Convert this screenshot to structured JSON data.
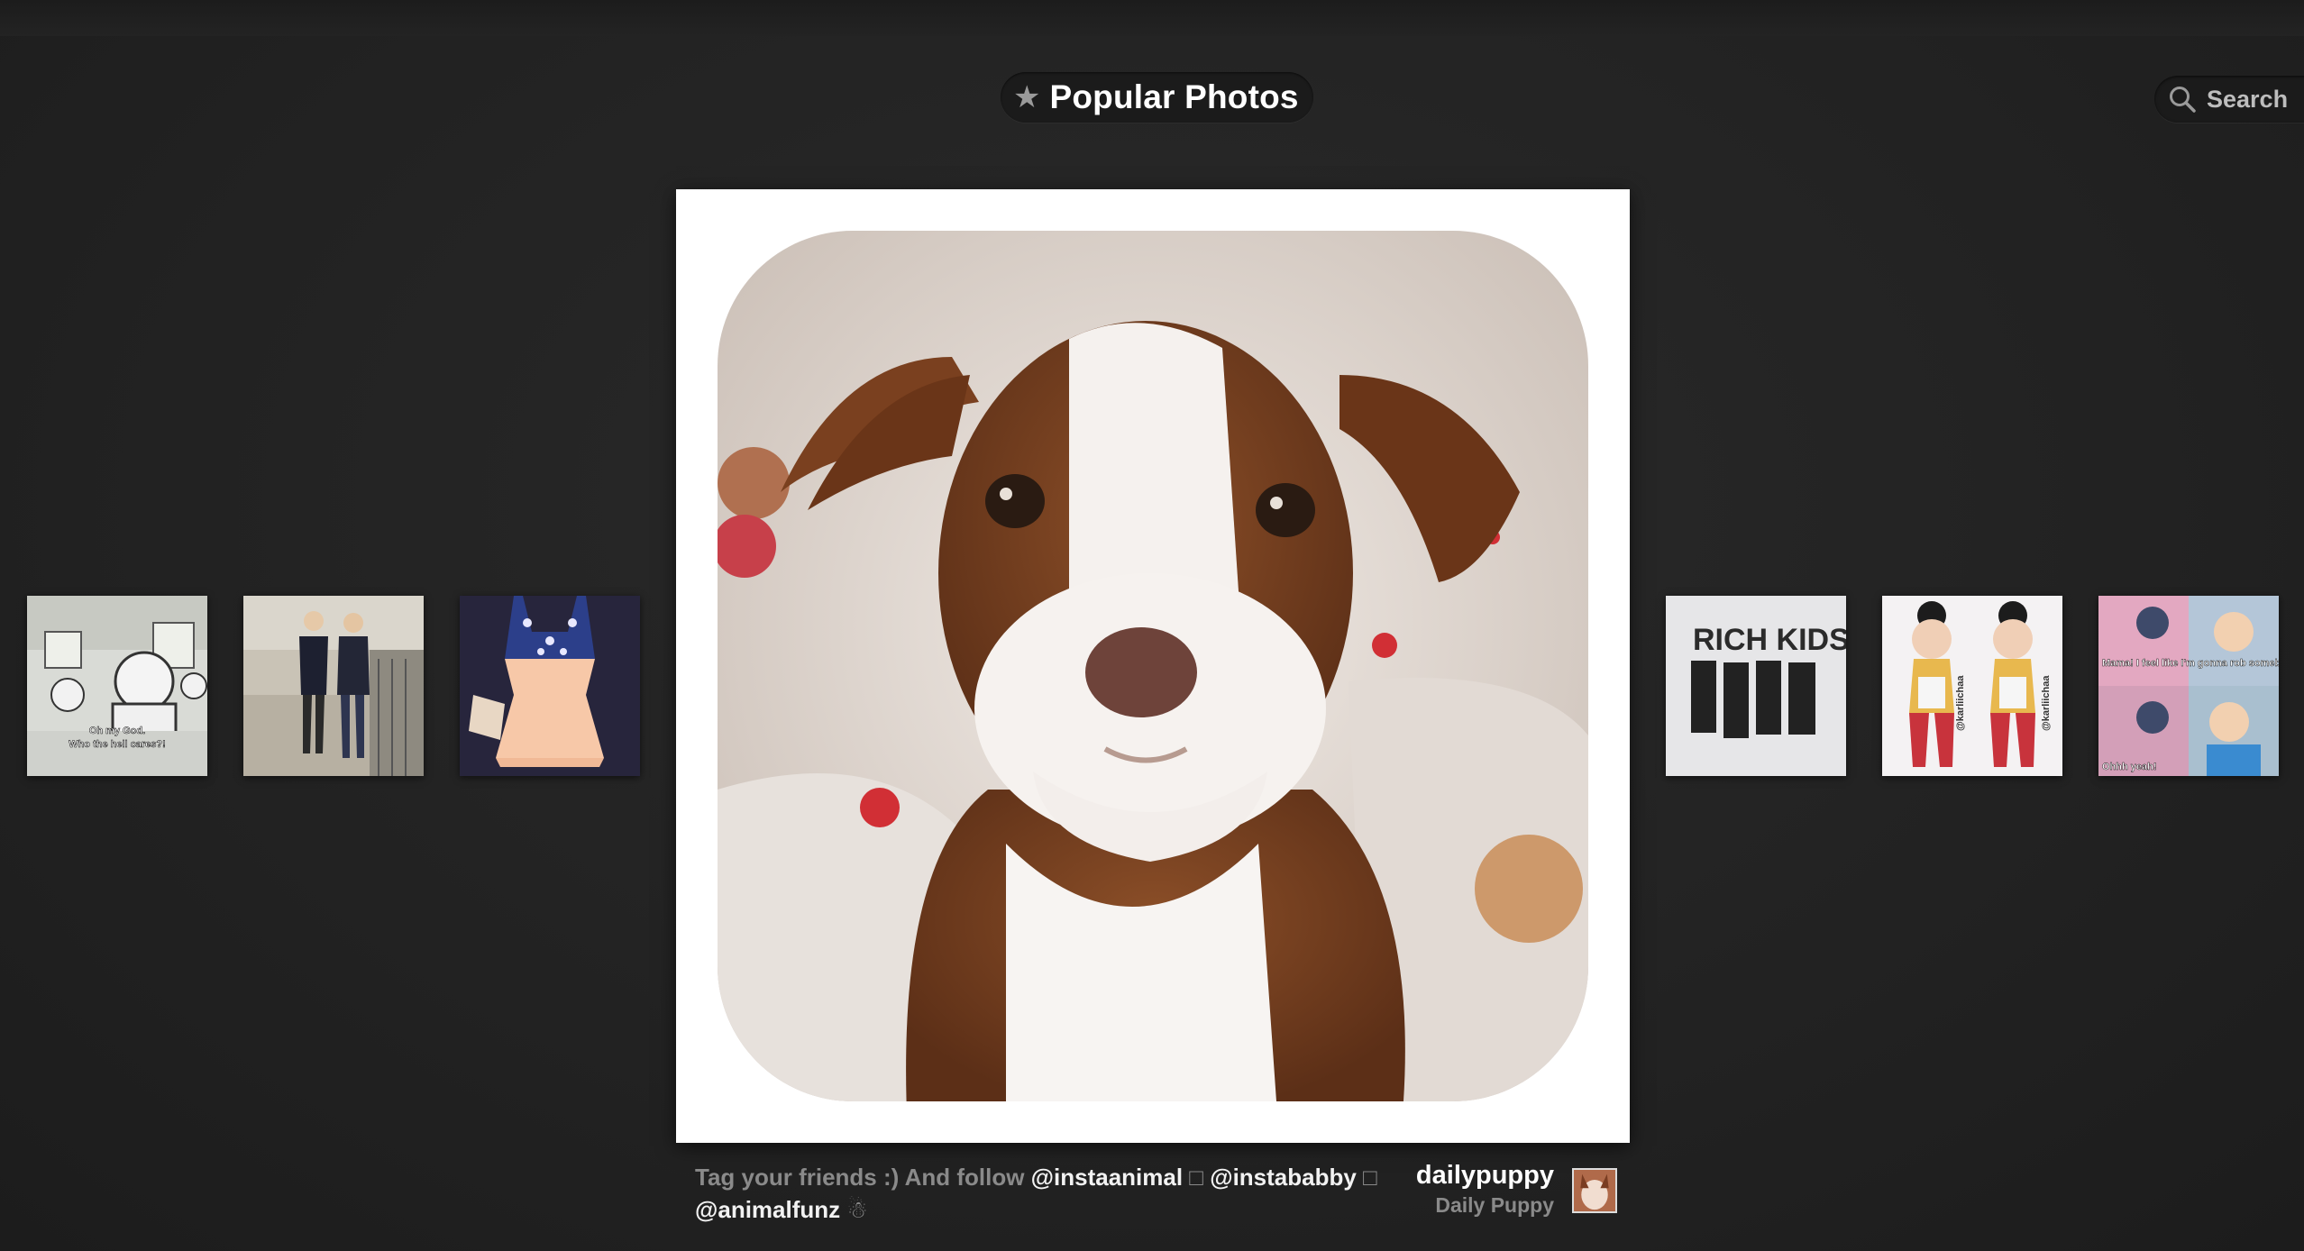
{
  "header": {
    "title": "Popular Photos",
    "star_icon": "star-icon",
    "search_label": "Search"
  },
  "thumbnails_left": [
    {
      "label": "Oh my God. Who the hell cares?!"
    },
    {
      "label": ""
    },
    {
      "label": ""
    }
  ],
  "thumbnails_right": [
    {
      "label": "RICH KIDS"
    },
    {
      "label": "@karliichaa"
    },
    {
      "label": "Mama! I feel like I'm gonna rob somebody!",
      "label2": "Ohhh yeah!"
    }
  ],
  "caption": {
    "text1": "Tag your friends :) And follow ",
    "mention1": "@instaanimal",
    "sep1": " □ ",
    "mention2": "@instababby",
    "sep2": " □ ",
    "mention3": "@animalfunz",
    "tail": " ☃"
  },
  "user": {
    "username": "dailypuppy",
    "fullname": "Daily Puppy"
  },
  "colors": {
    "background": "#232323",
    "frame": "#ffffff",
    "text_muted": "#8a8a8a",
    "text_bright": "#ffffff"
  }
}
